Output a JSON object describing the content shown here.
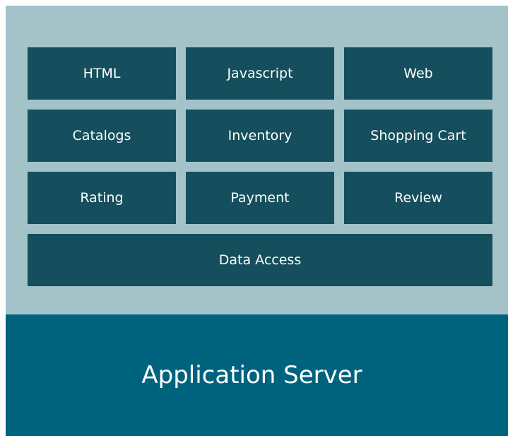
{
  "modules": [
    {
      "label": "HTML"
    },
    {
      "label": "Javascript"
    },
    {
      "label": "Web"
    },
    {
      "label": "Catalogs"
    },
    {
      "label": "Inventory"
    },
    {
      "label": "Shopping Cart"
    },
    {
      "label": "Rating"
    },
    {
      "label": "Payment"
    },
    {
      "label": "Review"
    },
    {
      "label": "Data Access"
    }
  ],
  "server": {
    "label": "Application Server"
  },
  "colors": {
    "panel_background": "#a3c3c9",
    "module_fill": "#154e5c",
    "server_fill": "#00637e",
    "text": "#ffffff"
  }
}
